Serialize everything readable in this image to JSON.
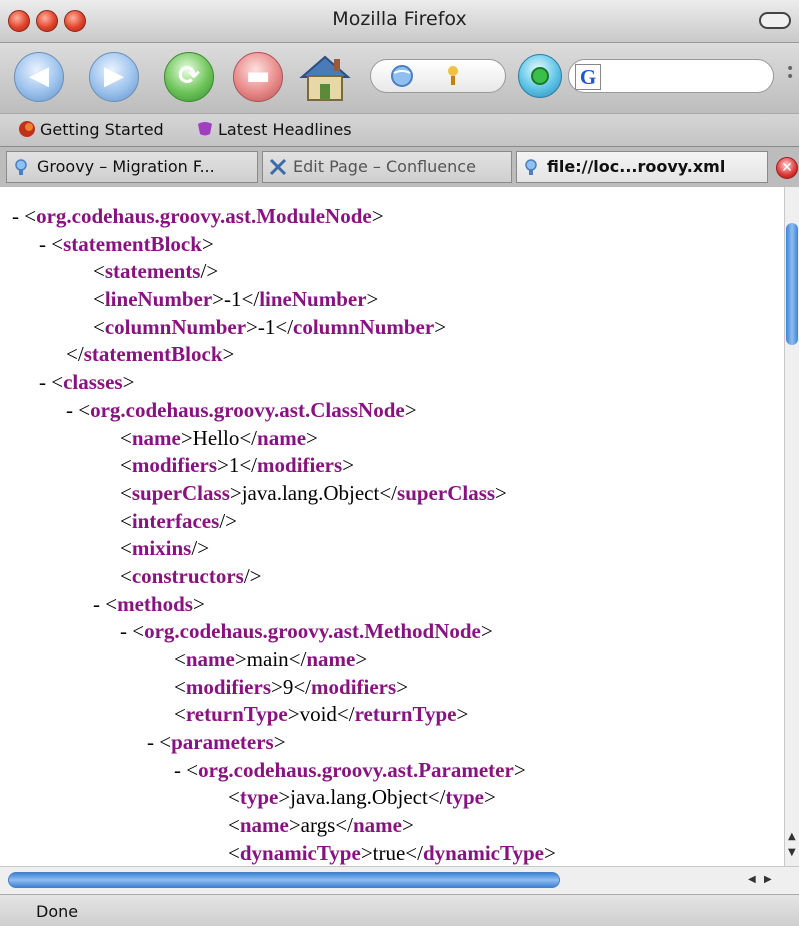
{
  "window": {
    "title": "Mozilla Firefox"
  },
  "toolbar": {
    "search_placeholder": "",
    "search_engine_letter": "G"
  },
  "bookmarks": [
    {
      "label": "Getting Started"
    },
    {
      "label": "Latest Headlines"
    }
  ],
  "tabs": [
    {
      "label": "Groovy – Migration F...",
      "active": false
    },
    {
      "label": "Edit Page – Confluence",
      "active": false
    },
    {
      "label": "file://loc...roovy.xml",
      "active": true
    }
  ],
  "xml_lines": [
    {
      "indent": 0,
      "toggle": "- ",
      "parts": [
        [
          "p",
          "<"
        ],
        [
          "t",
          "org.codehaus.groovy.ast.ModuleNode"
        ],
        [
          "p",
          ">"
        ]
      ]
    },
    {
      "indent": 1,
      "toggle": "- ",
      "parts": [
        [
          "p",
          "<"
        ],
        [
          "t",
          "statementBlock"
        ],
        [
          "p",
          ">"
        ]
      ]
    },
    {
      "indent": 3,
      "toggle": "",
      "parts": [
        [
          "p",
          "<"
        ],
        [
          "t",
          "statements"
        ],
        [
          "p",
          "/>"
        ]
      ]
    },
    {
      "indent": 3,
      "toggle": "",
      "parts": [
        [
          "p",
          "<"
        ],
        [
          "t",
          "lineNumber"
        ],
        [
          "p",
          ">-1</"
        ],
        [
          "t",
          "lineNumber"
        ],
        [
          "p",
          ">"
        ]
      ]
    },
    {
      "indent": 3,
      "toggle": "",
      "parts": [
        [
          "p",
          "<"
        ],
        [
          "t",
          "columnNumber"
        ],
        [
          "p",
          ">-1</"
        ],
        [
          "t",
          "columnNumber"
        ],
        [
          "p",
          ">"
        ]
      ]
    },
    {
      "indent": 2,
      "toggle": "",
      "parts": [
        [
          "p",
          "</"
        ],
        [
          "t",
          "statementBlock"
        ],
        [
          "p",
          ">"
        ]
      ]
    },
    {
      "indent": 1,
      "toggle": "- ",
      "parts": [
        [
          "p",
          "<"
        ],
        [
          "t",
          "classes"
        ],
        [
          "p",
          ">"
        ]
      ]
    },
    {
      "indent": 2,
      "toggle": "- ",
      "parts": [
        [
          "p",
          "<"
        ],
        [
          "t",
          "org.codehaus.groovy.ast.ClassNode"
        ],
        [
          "p",
          ">"
        ]
      ]
    },
    {
      "indent": 4,
      "toggle": "",
      "parts": [
        [
          "p",
          "<"
        ],
        [
          "t",
          "name"
        ],
        [
          "p",
          ">Hello</"
        ],
        [
          "t",
          "name"
        ],
        [
          "p",
          ">"
        ]
      ]
    },
    {
      "indent": 4,
      "toggle": "",
      "parts": [
        [
          "p",
          "<"
        ],
        [
          "t",
          "modifiers"
        ],
        [
          "p",
          ">1</"
        ],
        [
          "t",
          "modifiers"
        ],
        [
          "p",
          ">"
        ]
      ]
    },
    {
      "indent": 4,
      "toggle": "",
      "parts": [
        [
          "p",
          "<"
        ],
        [
          "t",
          "superClass"
        ],
        [
          "p",
          ">java.lang.Object</"
        ],
        [
          "t",
          "superClass"
        ],
        [
          "p",
          ">"
        ]
      ]
    },
    {
      "indent": 4,
      "toggle": "",
      "parts": [
        [
          "p",
          "<"
        ],
        [
          "t",
          "interfaces"
        ],
        [
          "p",
          "/>"
        ]
      ]
    },
    {
      "indent": 4,
      "toggle": "",
      "parts": [
        [
          "p",
          "<"
        ],
        [
          "t",
          "mixins"
        ],
        [
          "p",
          "/>"
        ]
      ]
    },
    {
      "indent": 4,
      "toggle": "",
      "parts": [
        [
          "p",
          "<"
        ],
        [
          "t",
          "constructors"
        ],
        [
          "p",
          "/>"
        ]
      ]
    },
    {
      "indent": 3,
      "toggle": "- ",
      "parts": [
        [
          "p",
          "<"
        ],
        [
          "t",
          "methods"
        ],
        [
          "p",
          ">"
        ]
      ]
    },
    {
      "indent": 4,
      "toggle": "- ",
      "parts": [
        [
          "p",
          "<"
        ],
        [
          "t",
          "org.codehaus.groovy.ast.MethodNode"
        ],
        [
          "p",
          ">"
        ]
      ]
    },
    {
      "indent": 6,
      "toggle": "",
      "parts": [
        [
          "p",
          "<"
        ],
        [
          "t",
          "name"
        ],
        [
          "p",
          ">main</"
        ],
        [
          "t",
          "name"
        ],
        [
          "p",
          ">"
        ]
      ]
    },
    {
      "indent": 6,
      "toggle": "",
      "parts": [
        [
          "p",
          "<"
        ],
        [
          "t",
          "modifiers"
        ],
        [
          "p",
          ">9</"
        ],
        [
          "t",
          "modifiers"
        ],
        [
          "p",
          ">"
        ]
      ]
    },
    {
      "indent": 6,
      "toggle": "",
      "parts": [
        [
          "p",
          "<"
        ],
        [
          "t",
          "returnType"
        ],
        [
          "p",
          ">void</"
        ],
        [
          "t",
          "returnType"
        ],
        [
          "p",
          ">"
        ]
      ]
    },
    {
      "indent": 5,
      "toggle": "- ",
      "parts": [
        [
          "p",
          "<"
        ],
        [
          "t",
          "parameters"
        ],
        [
          "p",
          ">"
        ]
      ]
    },
    {
      "indent": 6,
      "toggle": "- ",
      "parts": [
        [
          "p",
          "<"
        ],
        [
          "t",
          "org.codehaus.groovy.ast.Parameter"
        ],
        [
          "p",
          ">"
        ]
      ]
    },
    {
      "indent": 8,
      "toggle": "",
      "parts": [
        [
          "p",
          "<"
        ],
        [
          "t",
          "type"
        ],
        [
          "p",
          ">java.lang.Object</"
        ],
        [
          "t",
          "type"
        ],
        [
          "p",
          ">"
        ]
      ]
    },
    {
      "indent": 8,
      "toggle": "",
      "parts": [
        [
          "p",
          "<"
        ],
        [
          "t",
          "name"
        ],
        [
          "p",
          ">args</"
        ],
        [
          "t",
          "name"
        ],
        [
          "p",
          ">"
        ]
      ]
    },
    {
      "indent": 8,
      "toggle": "",
      "parts": [
        [
          "p",
          "<"
        ],
        [
          "t",
          "dynamicType"
        ],
        [
          "p",
          ">true</"
        ],
        [
          "t",
          "dynamicType"
        ],
        [
          "p",
          ">"
        ]
      ]
    }
  ],
  "status": {
    "text": "Done"
  },
  "colors": {
    "tag": "#881280",
    "text": "#000000",
    "scroll_thumb": "#3d83d6"
  },
  "icons": {
    "nav": [
      "back-arrow-icon",
      "forward-arrow-icon",
      "reload-icon",
      "stop-icon",
      "home-icon",
      "go-icon"
    ],
    "bookmarks": [
      "firefox-icon",
      "rss-icon"
    ],
    "tabs": [
      "page-icon",
      "confluence-icon",
      "page-icon"
    ]
  }
}
